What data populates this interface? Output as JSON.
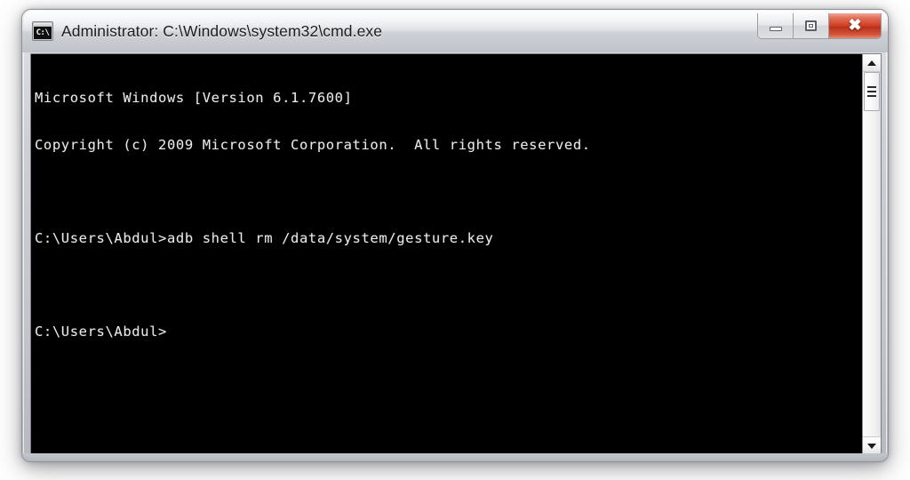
{
  "window": {
    "title": "Administrator: C:\\Windows\\system32\\cmd.exe",
    "icon_name": "cmd-console-icon",
    "icon_glyph": "C:\\",
    "controls": {
      "minimize_label": "",
      "maximize_label": "",
      "close_label": "✖"
    },
    "colors": {
      "titlebar": "#dfe1e5",
      "frame_border": "#8e9198",
      "close_button": "#cf3f22",
      "console_background": "#000000",
      "console_text": "#e9e9e9",
      "page_background": "#ffffff"
    }
  },
  "console": {
    "lines": [
      "Microsoft Windows [Version 6.1.7600]",
      "Copyright (c) 2009 Microsoft Corporation.  All rights reserved.",
      "",
      "C:\\Users\\Abdul>adb shell rm /data/system/gesture.key",
      "",
      "C:\\Users\\Abdul>"
    ]
  },
  "scrollbar": {
    "up_arrow": "scroll-up",
    "down_arrow": "scroll-down",
    "thumb": "scroll-thumb"
  }
}
